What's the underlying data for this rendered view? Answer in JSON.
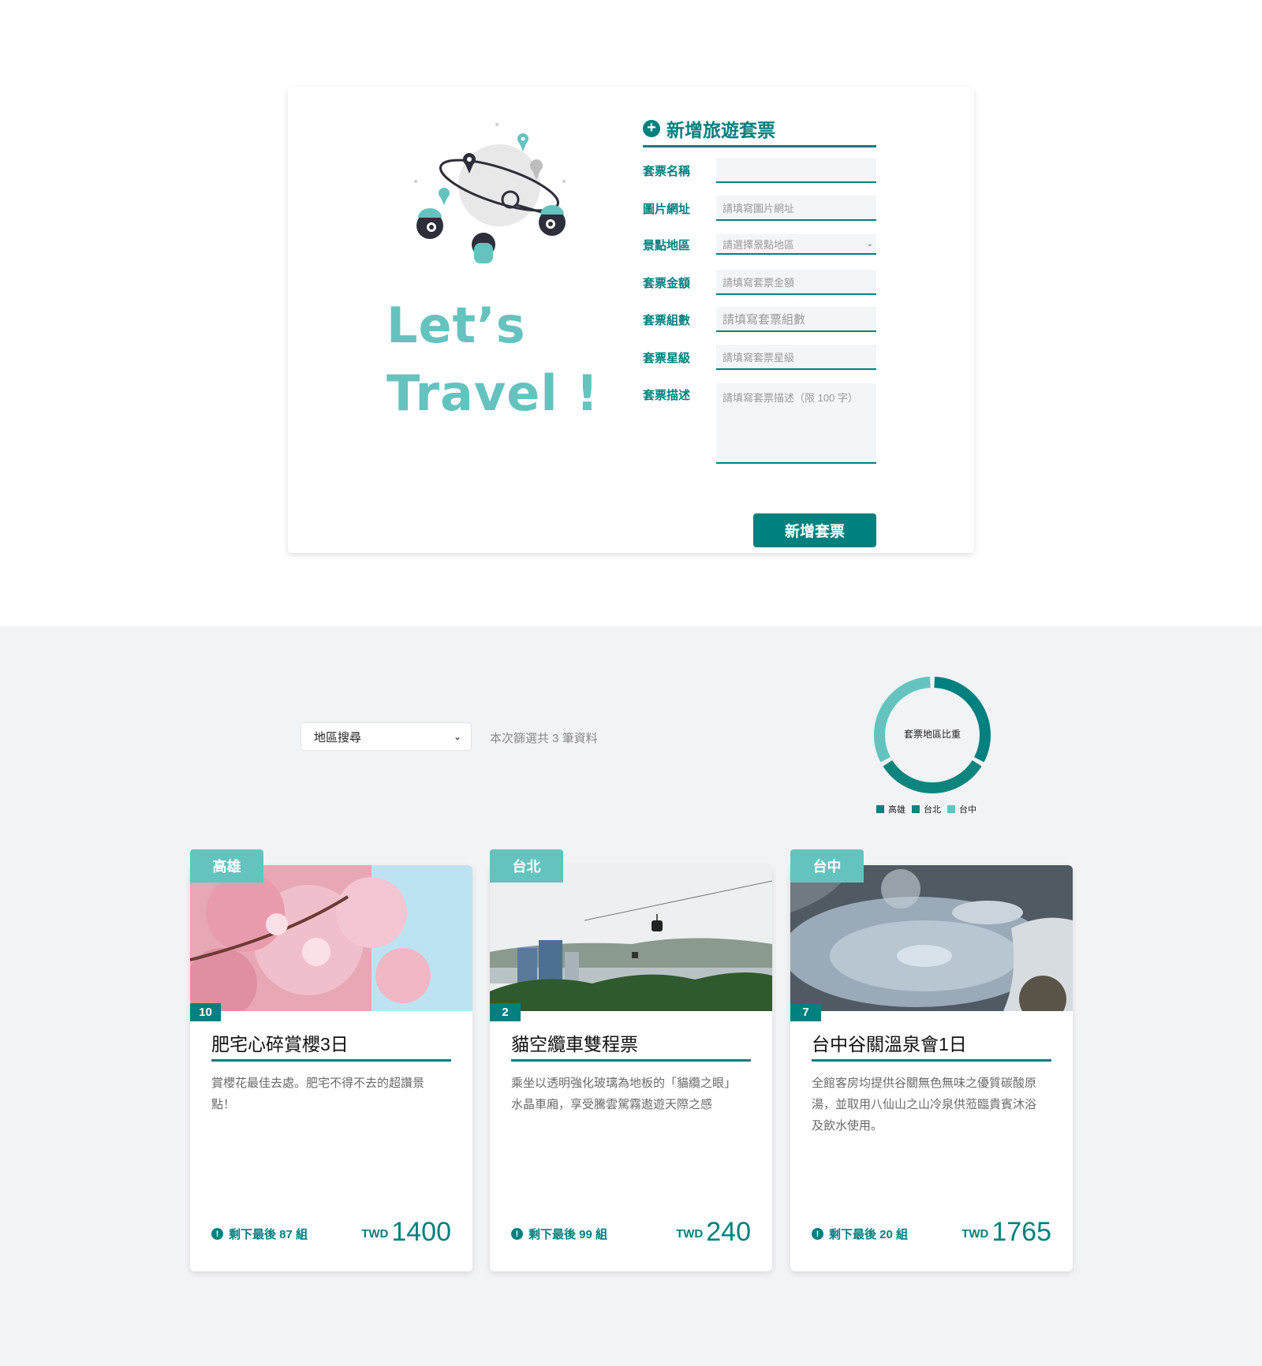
{
  "form": {
    "slogan_line1": "Let’s",
    "slogan_line2": "Travel !",
    "title": "新增旅遊套票",
    "fields": {
      "name": {
        "label": "套票名稱",
        "value": "",
        "placeholder": ""
      },
      "image": {
        "label": "圖片網址",
        "placeholder": "請填寫圖片網址"
      },
      "area": {
        "label": "景點地區",
        "placeholder": "請選擇景點地區"
      },
      "price": {
        "label": "套票金額",
        "placeholder": "請填寫套票金額"
      },
      "group": {
        "label": "套票組數",
        "placeholder": "請填寫套票組數"
      },
      "rate": {
        "label": "套票星級",
        "placeholder": "請填寫套票星級"
      },
      "description": {
        "label": "套票描述",
        "placeholder": "請填寫套票描述（限 100 字）"
      }
    },
    "submit_label": "新增套票"
  },
  "filter": {
    "select_label": "地區搜尋",
    "result_text": "本次篩選共 3 筆資料"
  },
  "chart_data": {
    "type": "pie",
    "title": "套票地區比重",
    "categories": [
      "高雄",
      "台北",
      "台中"
    ],
    "values": [
      1,
      1,
      1
    ],
    "colors": [
      "#26BFC7",
      "#5151D3",
      "#E68618"
    ],
    "display_colors": [
      "#00807E",
      "#0E847F",
      "#64C3BF"
    ],
    "legend_position": "bottom",
    "donut": true
  },
  "tickets": [
    {
      "area": "高雄",
      "rate": "10",
      "name": "肥宅心碎賞櫻3日",
      "description": "賞櫻花最佳去處。肥宅不得不去的超讚景點！",
      "remain": "剩下最後 87 組",
      "currency": "TWD",
      "price": "1400",
      "photo": "cherry-blossom"
    },
    {
      "area": "台北",
      "rate": "2",
      "name": "貓空纜車雙程票",
      "description": "乘坐以透明強化玻璃為地板的「貓纜之眼」水晶車廂，享受騰雲駕霧遨遊天際之感",
      "remain": "剩下最後 99 組",
      "currency": "TWD",
      "price": "240",
      "photo": "gondola-cityscape"
    },
    {
      "area": "台中",
      "rate": "7",
      "name": "台中谷關溫泉會1日",
      "description": "全館客房均提供谷關無色無味之優質碳酸原湯，並取用八仙山之山冷泉供蒞臨貴賓沐浴及飲水使用。",
      "remain": "剩下最後 20 組",
      "currency": "TWD",
      "price": "1765",
      "photo": "hot-spring"
    }
  ]
}
